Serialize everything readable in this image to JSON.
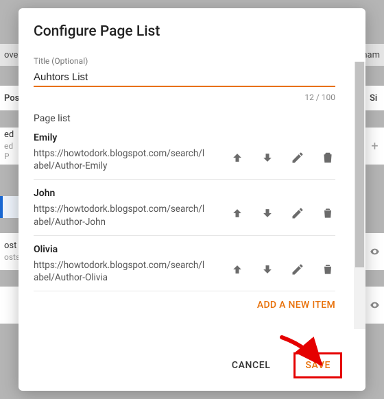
{
  "bg": {
    "leftHeader": "Pos",
    "rightHeader": "Si",
    "row1a": "ed",
    "row1b": "ed P",
    "row3": "ost",
    "row3b": "osts",
    "plus": "+",
    "hamb": "ham",
    "ove": "ove"
  },
  "dialogTitle": "Configure Page List",
  "fieldLabel": "Title (Optional)",
  "titleValue": "Auhtors List",
  "counter": "12 / 100",
  "sectionLabel": "Page list",
  "pages": [
    {
      "name": "Emily",
      "url": "https://howtodork.blogspot.com/search/label/Author-Emily"
    },
    {
      "name": "John",
      "url": "https://howtodork.blogspot.com/search/label/Author-John"
    },
    {
      "name": "Olivia",
      "url": "https://howtodork.blogspot.com/search/label/Author-Olivia"
    }
  ],
  "addItem": "ADD A NEW ITEM",
  "cancel": "CANCEL",
  "save": "SAVE"
}
